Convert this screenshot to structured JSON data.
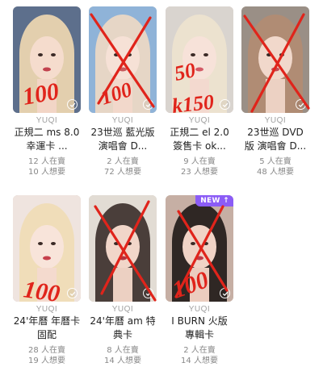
{
  "accent": "#8b5cf6",
  "annotation_color": "#e0241b",
  "cards": [
    {
      "brand": "YUQI",
      "title": "正規二 ms 8.0 幸運卡 ...",
      "selling": "12 人在賣",
      "wanting": "10 人想要",
      "hair": "#e3cfae",
      "bg": "#5d6f8c",
      "badge": ""
    },
    {
      "brand": "YUQI",
      "title": "23世巡 藍光版 演唱會 D...",
      "selling": "2 人在賣",
      "wanting": "72 人想要",
      "hair": "#e6d6c6",
      "bg": "#8fb3d8",
      "badge": ""
    },
    {
      "brand": "YUQI",
      "title": "正規二 el 2.0 簽售卡 ok...",
      "selling": "9 人在賣",
      "wanting": "23 人想要",
      "hair": "#ece2cf",
      "bg": "#d9d4cf",
      "badge": ""
    },
    {
      "brand": "YUQI",
      "title": "23世巡 DVD 版 演唱會 D...",
      "selling": "5 人在賣",
      "wanting": "48 人想要",
      "hair": "#b08c74",
      "bg": "#9a8f86",
      "badge": ""
    },
    {
      "brand": "YUQI",
      "title": "24'年曆 年曆卡 固配",
      "selling": "28 人在賣",
      "wanting": "19 人想要",
      "hair": "#f0ddb9",
      "bg": "#efe4df",
      "badge": ""
    },
    {
      "brand": "YUQI",
      "title": "24'年曆 am 特典卡",
      "selling": "8 人在賣",
      "wanting": "14 人想要",
      "hair": "#4a3e3a",
      "bg": "#e2dcd4",
      "badge": ""
    },
    {
      "brand": "YUQI",
      "title": "I BURN 火版 專輯卡",
      "selling": "2 人在賣",
      "wanting": "14 人想要",
      "hair": "#2f2724",
      "bg": "#c6afa4",
      "badge": "NEW ↑"
    }
  ],
  "annotations": [
    "100",
    "100",
    "50",
    "k150",
    "100",
    "100"
  ]
}
